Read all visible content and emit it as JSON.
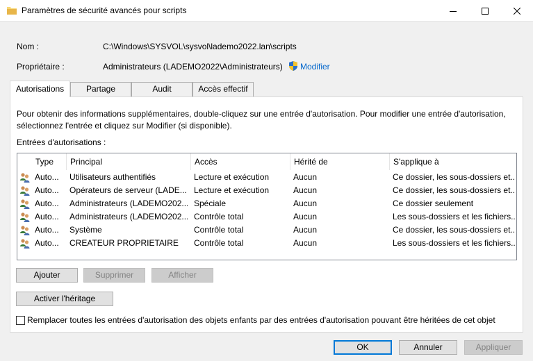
{
  "window": {
    "title": "Paramètres de sécurité avancés pour scripts",
    "icon": "folder-icon"
  },
  "fields": {
    "name_label": "Nom :",
    "name_value": "C:\\Windows\\SYSVOL\\sysvol\\lademo2022.lan\\scripts",
    "owner_label": "Propriétaire :",
    "owner_value": "Administrateurs (LADEMO2022\\Administrateurs)",
    "modify_link": "Modifier"
  },
  "tabs": [
    {
      "label": "Autorisations",
      "active": true
    },
    {
      "label": "Partage",
      "active": false
    },
    {
      "label": "Audit",
      "active": false
    },
    {
      "label": "Accès effectif",
      "active": false
    }
  ],
  "panel": {
    "info_line1": "Pour obtenir des informations supplémentaires, double-cliquez sur une entrée d'autorisation. Pour modifier une entrée d'autorisation,",
    "info_line2": "sélectionnez l'entrée et cliquez sur Modifier (si disponible).",
    "entries_label": "Entrées d'autorisations :",
    "columns": [
      "Type",
      "Principal",
      "Accès",
      "Hérité de",
      "S'applique à"
    ],
    "rows": [
      {
        "type": "Auto...",
        "principal": "Utilisateurs authentifiés",
        "access": "Lecture et exécution",
        "inherited": "Aucun",
        "applies": "Ce dossier, les sous-dossiers et..."
      },
      {
        "type": "Auto...",
        "principal": "Opérateurs de serveur (LADE...",
        "access": "Lecture et exécution",
        "inherited": "Aucun",
        "applies": "Ce dossier, les sous-dossiers et..."
      },
      {
        "type": "Auto...",
        "principal": "Administrateurs (LADEMO202...",
        "access": "Spéciale",
        "inherited": "Aucun",
        "applies": "Ce dossier seulement"
      },
      {
        "type": "Auto...",
        "principal": "Administrateurs (LADEMO202...",
        "access": "Contrôle total",
        "inherited": "Aucun",
        "applies": "Les sous-dossiers et les fichiers..."
      },
      {
        "type": "Auto...",
        "principal": "Système",
        "access": "Contrôle total",
        "inherited": "Aucun",
        "applies": "Ce dossier, les sous-dossiers et..."
      },
      {
        "type": "Auto...",
        "principal": "CREATEUR PROPRIETAIRE",
        "access": "Contrôle total",
        "inherited": "Aucun",
        "applies": "Les sous-dossiers et les fichiers..."
      }
    ],
    "buttons": {
      "add": "Ajouter",
      "remove": "Supprimer",
      "view": "Afficher",
      "enable_inheritance": "Activer l'héritage"
    },
    "replace_checkbox_label": "Remplacer toutes les entrées d'autorisation des objets enfants par des entrées d'autorisation pouvant être héritées de cet objet",
    "replace_checked": false
  },
  "footer": {
    "ok": "OK",
    "cancel": "Annuler",
    "apply": "Appliquer"
  },
  "colors": {
    "accent": "#0078d7",
    "link": "#0066cc",
    "window_bg": "#f0f0f0"
  }
}
